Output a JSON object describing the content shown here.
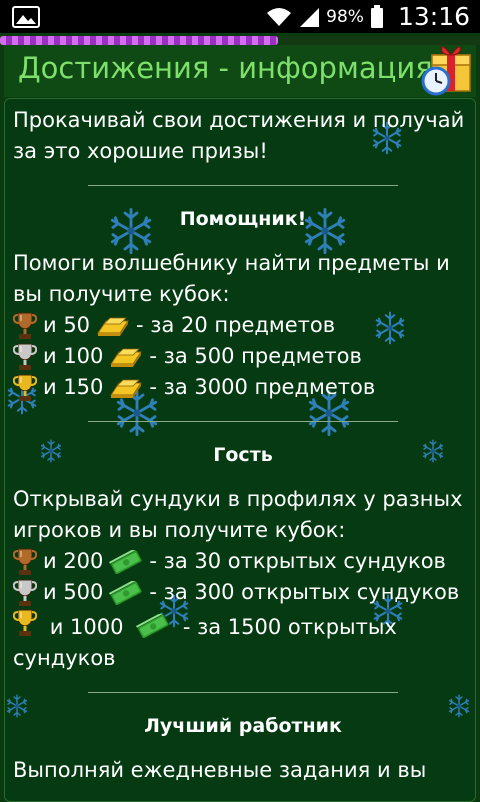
{
  "status_bar": {
    "battery": "98%",
    "time": "13:16"
  },
  "progress": {
    "value": 0.58
  },
  "title": "Достижения - информация",
  "intro": "Прокачивай свои достижения и получай за это хорошие призы!",
  "sections": [
    {
      "title": "Помощник!",
      "description": "Помоги волшебнику найти предметы и вы получите кубок:",
      "currency_icon": "gold-bar-icon",
      "rewards": [
        {
          "cup": "bronze-cup-icon",
          "amount": "и 50",
          "condition": "- за 20 предметов"
        },
        {
          "cup": "silver-cup-icon",
          "amount": "и 100",
          "condition": "- за 500 предметов"
        },
        {
          "cup": "gold-cup-icon",
          "amount": "и 150",
          "condition": "- за 3000 предметов"
        }
      ]
    },
    {
      "title": "Гость",
      "description": "Открывай сундуки в профилях у разных игроков и вы получите кубок:",
      "currency_icon": "cash-bundle-icon",
      "rewards": [
        {
          "cup": "bronze-cup-icon",
          "amount": "и 200",
          "condition": "- за 30 открытых сундуков"
        },
        {
          "cup": "silver-cup-icon",
          "amount": "и 500",
          "condition": "- за 300 открытых сундуков"
        },
        {
          "cup": "gold-cup-icon",
          "amount": "и 1000",
          "condition": "- за 1500 открытых сундуков"
        }
      ]
    },
    {
      "title": "Лучший работник",
      "description": "Выполняй ежедневные задания и вы"
    }
  ],
  "colors": {
    "title_text": "#7ee06a",
    "background": "#053a12",
    "progress": "#c45be8",
    "bronze": "#b06a2a",
    "silver": "#c8c8c8",
    "gold": "#e8b820"
  }
}
